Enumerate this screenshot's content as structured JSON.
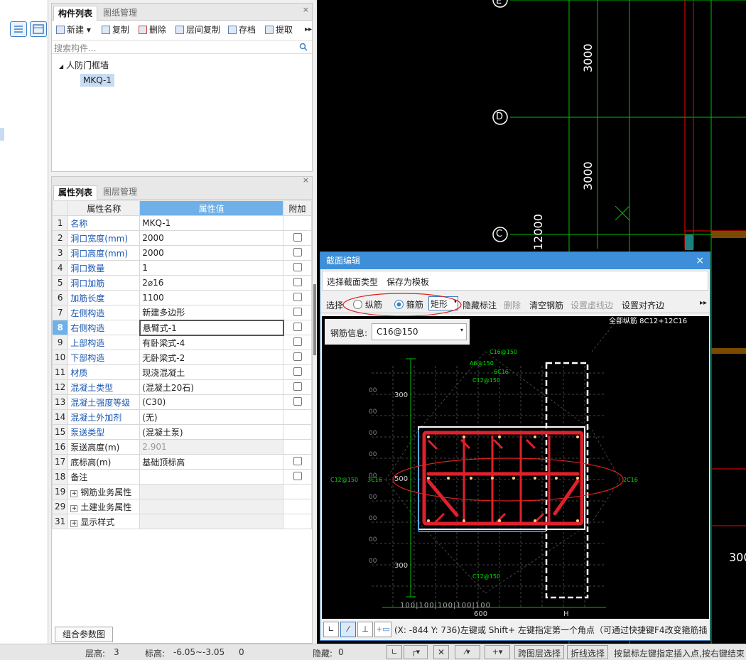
{
  "component_panel": {
    "tabs": [
      "构件列表",
      "图纸管理"
    ],
    "toolbar": [
      "新建",
      "复制",
      "删除",
      "层间复制",
      "存档",
      "提取"
    ],
    "search_placeholder": "搜索构件...",
    "tree_root": "人防门框墙",
    "tree_child": "MKQ-1"
  },
  "props_panel": {
    "tabs": [
      "属性列表",
      "图层管理"
    ],
    "headers": [
      "属性名称",
      "属性值",
      "附加"
    ],
    "rows": [
      {
        "n": "1",
        "name": "名称",
        "val": "MKQ-1",
        "chk": false,
        "blue": true
      },
      {
        "n": "2",
        "name": "洞口宽度(mm)",
        "val": "2000",
        "chk": true,
        "blue": true
      },
      {
        "n": "3",
        "name": "洞口高度(mm)",
        "val": "2000",
        "chk": true,
        "blue": true
      },
      {
        "n": "4",
        "name": "洞口数量",
        "val": "1",
        "chk": true,
        "blue": true
      },
      {
        "n": "5",
        "name": "洞口加筋",
        "val": "2⌀16",
        "chk": true,
        "blue": true
      },
      {
        "n": "6",
        "name": "加筋长度",
        "val": "1100",
        "chk": true,
        "blue": true
      },
      {
        "n": "7",
        "name": "左侧构造",
        "val": "新建多边形",
        "chk": true,
        "blue": true
      },
      {
        "n": "8",
        "name": "右侧构造",
        "val": "悬臂式-1",
        "chk": true,
        "blue": true
      },
      {
        "n": "9",
        "name": "上部构造",
        "val": "有卧梁式-4",
        "chk": true,
        "blue": true
      },
      {
        "n": "10",
        "name": "下部构造",
        "val": "无卧梁式-2",
        "chk": true,
        "blue": true
      },
      {
        "n": "11",
        "name": "材质",
        "val": "现浇混凝土",
        "chk": true,
        "blue": true
      },
      {
        "n": "12",
        "name": "混凝土类型",
        "val": "(混凝土20石)",
        "chk": true,
        "blue": true
      },
      {
        "n": "13",
        "name": "混凝土强度等级",
        "val": "(C30)",
        "chk": true,
        "blue": true
      },
      {
        "n": "14",
        "name": "混凝土外加剂",
        "val": "(无)",
        "chk": false,
        "blue": true
      },
      {
        "n": "15",
        "name": "泵送类型",
        "val": "(混凝土泵)",
        "chk": false,
        "blue": true
      },
      {
        "n": "16",
        "name": "泵送高度(m)",
        "val": "2.901",
        "chk": false,
        "blue": false
      },
      {
        "n": "17",
        "name": "底标高(m)",
        "val": "基础顶标高",
        "chk": true,
        "blue": false
      },
      {
        "n": "18",
        "name": "备注",
        "val": "",
        "chk": true,
        "blue": false
      },
      {
        "n": "19",
        "name": "钢筋业务属性",
        "val": "",
        "chk": false,
        "blue": false,
        "grp": true
      },
      {
        "n": "29",
        "name": "土建业务属性",
        "val": "",
        "chk": false,
        "blue": false,
        "grp": true
      },
      {
        "n": "31",
        "name": "显示样式",
        "val": "",
        "chk": false,
        "blue": false,
        "grp": true
      }
    ],
    "bottom_button": "组合参数图"
  },
  "cad": {
    "axis_labels": [
      "E",
      "D",
      "C"
    ],
    "dims": [
      "3000",
      "3000",
      "12000",
      "300"
    ]
  },
  "dialog": {
    "title": "截面编辑",
    "menu": [
      "选择截面类型",
      "保存为模板"
    ],
    "toolbar": {
      "select": "选择",
      "radio1": "纵筋",
      "radio2": "箍筋",
      "shape": "矩形",
      "hide_label": "隐藏标注",
      "delete": "删除",
      "clear": "清空钢筋",
      "set_dash": "设置虚线边",
      "align": "设置对齐边"
    },
    "rebar_label": "钢筋信息:",
    "rebar_value": "C16@150",
    "drawing_labels": {
      "top_note": "全部纵筋 8C12+12C16",
      "c16_150": "C16@150",
      "a6_150": "A6@150",
      "c6c16": "6C16",
      "c12_150a": "C12@150",
      "c12_150b": "C12@150",
      "c12_150c": "C12@150",
      "c16_right": "2C16",
      "c16_left": "3C16",
      "d300a": "300",
      "d500": "500",
      "d300b": "300",
      "d600": "600",
      "dH": "H",
      "g100": "100",
      "g00": "00"
    },
    "coord_text": "(X: -844 Y: 736)左键或 Shift+ 左键指定第一个角点（可通过快捷键F4改变箍筋插入点）"
  },
  "status": {
    "floor": "层高:",
    "floor_v": "3",
    "elev": "标高:",
    "elev_v": "-6.05~-3.05",
    "zero": "0",
    "hidden": "隐藏:",
    "hidden_v": "0",
    "b1": "跨图层选择",
    "b2": "折线选择",
    "hint": "按鼠标左键指定插入点,按右键结束"
  }
}
